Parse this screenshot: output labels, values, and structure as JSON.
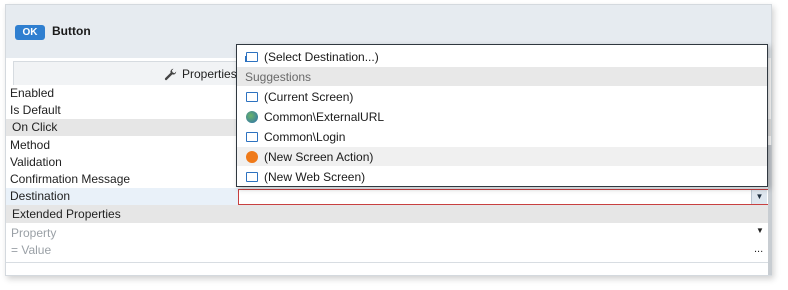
{
  "header": {
    "badge": "OK",
    "title": "Button"
  },
  "tab": {
    "label": "Properties",
    "icon": "wrench-icon"
  },
  "properties": [
    {
      "label": "Enabled",
      "section": false
    },
    {
      "label": "Is Default",
      "section": false
    },
    {
      "label": "On Click",
      "section": true
    },
    {
      "label": "Method",
      "section": false
    },
    {
      "label": "Validation",
      "section": false
    },
    {
      "label": "Confirmation Message",
      "section": false
    },
    {
      "label": "Destination",
      "section": false
    }
  ],
  "extended": {
    "header": "Extended Properties",
    "property_placeholder": "Property",
    "value_placeholder": "=  Value",
    "value_more": "..."
  },
  "dropdown": {
    "items": [
      {
        "label": "(Select Destination...)",
        "icon": "select-destination-icon",
        "kind": "item"
      },
      {
        "label": "Suggestions",
        "icon": "",
        "kind": "header"
      },
      {
        "label": "(Current Screen)",
        "icon": "screen-icon",
        "kind": "item"
      },
      {
        "label": "Common\\ExternalURL",
        "icon": "globe-icon",
        "kind": "item"
      },
      {
        "label": "Common\\Login",
        "icon": "screen-icon",
        "kind": "item"
      },
      {
        "label": "(New Screen Action)",
        "icon": "screen-action-icon",
        "kind": "hover"
      },
      {
        "label": "(New Web Screen)",
        "icon": "screen-icon",
        "kind": "item"
      }
    ]
  },
  "colors": {
    "badge": "#2f7fd0",
    "header_bg": "#e6ebf0",
    "field_border": "#c84040",
    "action_icon": "#ef7a1a"
  }
}
